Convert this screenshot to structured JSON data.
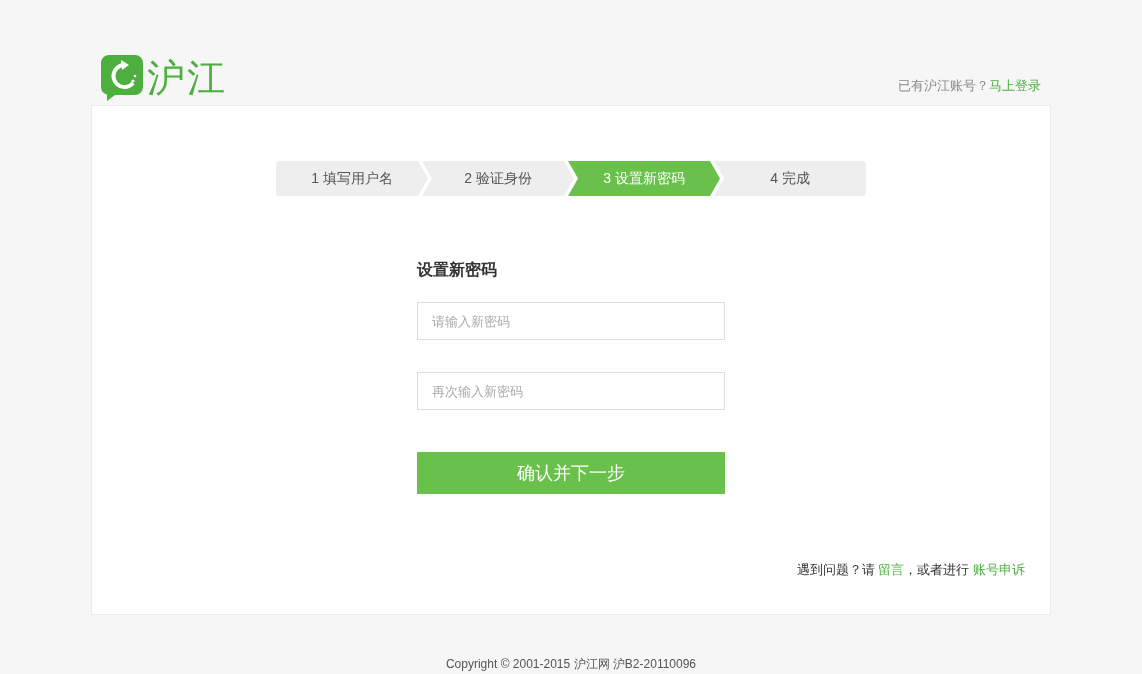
{
  "logo": {
    "text": "沪江"
  },
  "header": {
    "prompt": "已有沪江账号？",
    "link": "马上登录"
  },
  "steps": [
    {
      "label": "1 填写用户名",
      "selected": false
    },
    {
      "label": "2 验证身份",
      "selected": false
    },
    {
      "label": "3 设置新密码",
      "selected": true
    },
    {
      "label": "4 完成",
      "selected": false
    }
  ],
  "form": {
    "title": "设置新密码",
    "fields": [
      {
        "placeholder": "请输入新密码"
      },
      {
        "placeholder": "再次输入新密码"
      }
    ],
    "submit": "确认并下一步"
  },
  "help": {
    "before": "遇到问题？请 ",
    "link_1": "留言",
    "middle": "，或者进行 ",
    "link_2": "账号申诉"
  },
  "footer": {
    "copyright": "Copyright © 2001-2015 沪江网 沪B2-20110096"
  }
}
